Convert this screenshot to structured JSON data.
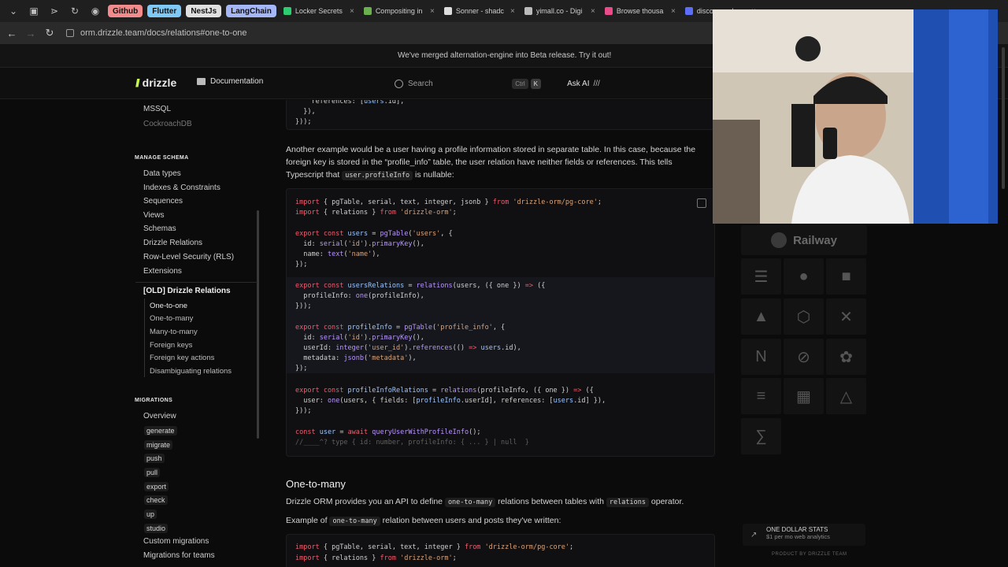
{
  "browser": {
    "bookmarks": [
      {
        "label": "Github",
        "color": "#f28b8b"
      },
      {
        "label": "Flutter",
        "color": "#7ec9f5"
      },
      {
        "label": "NestJs",
        "color": "#e0e0e0"
      },
      {
        "label": "LangChain",
        "color": "#a6b7f7"
      }
    ],
    "tabs": [
      {
        "label": "Locker Secrets",
        "color": "#2ecc71"
      },
      {
        "label": "Compositing in",
        "color": "#6ab04c"
      },
      {
        "label": "Sonner - shadc",
        "color": "#dddddd"
      },
      {
        "label": "yimall.co - Digi",
        "color": "#bbbbbb"
      },
      {
        "label": "Browse thousa",
        "color": "#ea4c89"
      },
      {
        "label": "disco-app.dra",
        "color": "#5b6ef5"
      }
    ],
    "url": "orm.drizzle.team/docs/relations#one-to-one"
  },
  "banner": {
    "text": "We've merged alternation-engine into Beta release. Try it out!"
  },
  "header": {
    "logo": "drizzle",
    "docs_label": "Documentation",
    "search_placeholder": "Search",
    "search_kbd": [
      "Ctrl",
      "K"
    ],
    "ask_ai": "Ask AI"
  },
  "sidebar": {
    "top_items": [
      "MSSQL",
      "CockroachDB"
    ],
    "manage_schema_title": "MANAGE SCHEMA",
    "manage_schema": [
      "Data types",
      "Indexes & Constraints",
      "Sequences",
      "Views",
      "Schemas",
      "Drizzle Relations",
      "Row-Level Security (RLS)",
      "Extensions"
    ],
    "old_relations": "[OLD] Drizzle Relations",
    "old_sub": [
      "One-to-one",
      "One-to-many",
      "Many-to-many",
      "Foreign keys",
      "Foreign key actions",
      "Disambiguating relations"
    ],
    "migrations_title": "MIGRATIONS",
    "migrations_overview": "Overview",
    "migrations_cmds": [
      "generate",
      "migrate",
      "push",
      "pull",
      "export",
      "check",
      "up",
      "studio"
    ],
    "migrations_more": [
      "Custom migrations",
      "Migrations for teams"
    ]
  },
  "main": {
    "para1_a": "Another example would be a user having a profile information stored in separate table. In this case, because the foreign key is stored in the “profile_info” table, the user relation have neither fields or references. This tells Typescript that ",
    "para1_code": "user.profileInfo",
    "para1_b": " is nullable:",
    "h2": "One-to-many",
    "para2_a": "Drizzle ORM provides you an API to define ",
    "para2_code1": "one-to-many",
    "para2_b": " relations between tables with ",
    "para2_code2": "relations",
    "para2_c": " operator.",
    "para3_a": "Example of ",
    "para3_code": "one-to-many",
    "para3_b": " relation between users and posts they've written:"
  },
  "right": {
    "railway": "Railway",
    "one_dollar_title": "ONE DOLLAR STATS",
    "one_dollar_sub": "$1 per mo web analytics",
    "product_by": "PRODUCT BY DRIZZLE TEAM"
  }
}
